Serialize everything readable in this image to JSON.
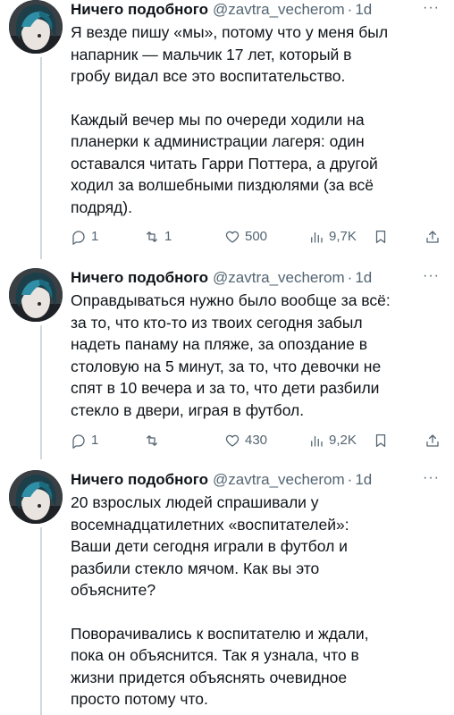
{
  "tweets": [
    {
      "author_name": "Ничего подобного",
      "handle": "@zavtra_vecherom",
      "separator": "·",
      "time": "1d",
      "more": "···",
      "paragraphs": [
        [
          "Я везде пишу «мы», потому что у меня был",
          "напарник — мальчик 17 лет, который в",
          "гробу видал все это воспитательство."
        ],
        [
          "Каждый вечер мы по очереди ходили на",
          "планерки к администрации лагеря: один",
          "оставался читать Гарри Поттера, а другой",
          "ходил за волшебными пиздюлями (за всё",
          "подряд)."
        ]
      ],
      "replies": "1",
      "reposts": "1",
      "likes": "500",
      "views": "9,7K"
    },
    {
      "author_name": "Ничего подобного",
      "handle": "@zavtra_vecherom",
      "separator": "·",
      "time": "1d",
      "more": "···",
      "paragraphs": [
        [
          "Оправдываться нужно было вообще за всё:",
          "за то, что кто-то из твоих сегодня забыл",
          "надеть панаму на пляже, за опоздание в",
          "столовую на 5 минут, за то, что девочки не",
          "спят в 10 вечера и за то, что дети разбили",
          "стекло в двери, играя в футбол."
        ]
      ],
      "replies": "1",
      "reposts": "",
      "likes": "430",
      "views": "9,2K"
    },
    {
      "author_name": "Ничего подобного",
      "handle": "@zavtra_vecherom",
      "separator": "·",
      "time": "1d",
      "more": "···",
      "paragraphs": [
        [
          "20 взрослых людей спрашивали у",
          "восемнадцатилетних «воспитателей»:",
          "Ваши дети сегодня играли в футбол и",
          "разбили стекло мячом. Как вы это",
          "объясните?"
        ],
        [
          "Поворачивались к воспитателю и ждали,",
          "пока он объяснится. Так я узнала, что в",
          "жизни придется объяснять очевидное",
          "просто потому что."
        ]
      ]
    }
  ],
  "icons": {
    "reply": "reply-icon",
    "repost": "repost-icon",
    "like": "heart-icon",
    "views": "views-icon",
    "bookmark": "bookmark-icon",
    "share": "share-icon"
  },
  "colors": {
    "text": "#0f1419",
    "secondary": "#536471",
    "thread_line": "#cfd9de"
  }
}
